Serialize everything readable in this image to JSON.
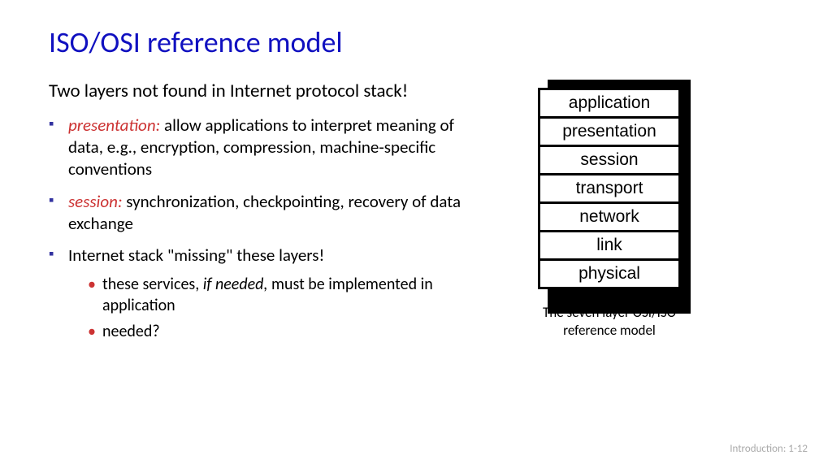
{
  "title": "ISO/OSI reference model",
  "intro": "Two layers not found in  Internet protocol stack!",
  "bullets": [
    {
      "term": "presentation:",
      "rest": " allow applications to interpret meaning of data, e.g., encryption, compression, machine-specific conventions"
    },
    {
      "term": "session:",
      "rest": " synchronization, checkpointing, recovery of data exchange"
    },
    {
      "term": "",
      "rest": "Internet stack \"missing\" these layers!"
    }
  ],
  "subbullets": [
    {
      "pre": "these services, ",
      "italic": "if needed,",
      "post": " must be implemented in application"
    },
    {
      "pre": "needed?",
      "italic": "",
      "post": ""
    }
  ],
  "layers": [
    "application",
    "presentation",
    "session",
    "transport",
    "network",
    "link",
    "physical"
  ],
  "caption_line1": "The seven layer OSI/ISO",
  "caption_line2": "reference model",
  "footer": "Introduction: 1-12"
}
